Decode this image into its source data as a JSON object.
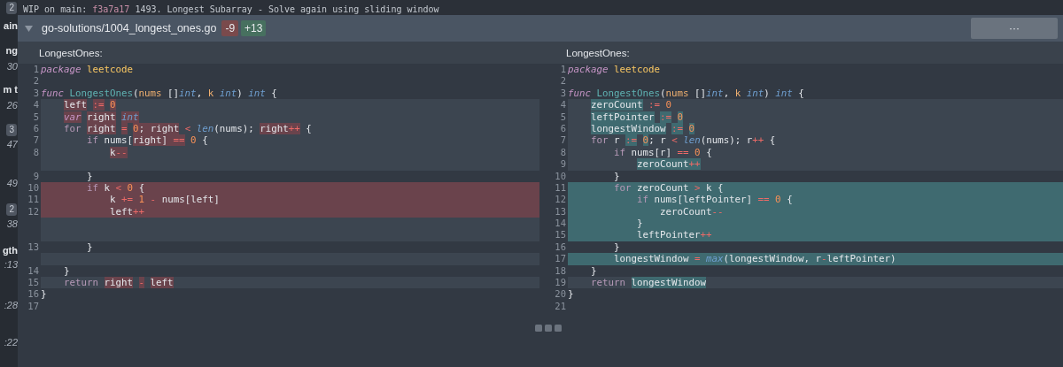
{
  "sidebar": {
    "items": [
      {
        "kind": "badge",
        "text": "2"
      },
      {
        "kind": "label",
        "text": "ain"
      },
      {
        "kind": "label",
        "text": "ng"
      },
      {
        "kind": "time",
        "text": "30"
      },
      {
        "kind": "label",
        "text": "m t"
      },
      {
        "kind": "time",
        "text": "26"
      },
      {
        "kind": "badge",
        "text": "3"
      },
      {
        "kind": "time",
        "text": "47"
      },
      {
        "kind": "time",
        "text": "49"
      },
      {
        "kind": "badge",
        "text": "2"
      },
      {
        "kind": "time",
        "text": "38"
      },
      {
        "kind": "label",
        "text": "gth"
      },
      {
        "kind": "time",
        "text": ":13"
      },
      {
        "kind": "time",
        "text": ":28"
      },
      {
        "kind": "time",
        "text": ":22"
      }
    ]
  },
  "commit": {
    "prefix": "WIP on main:",
    "hash": "f3a7a17",
    "message": "1493. Longest Subarray - Solve again using sliding window"
  },
  "file_header": {
    "expanded": true,
    "path": "go-solutions/1004_longest_ones.go",
    "deletions": "-9",
    "additions": "+13",
    "more": "···"
  },
  "panes": [
    {
      "title": "LongestOnes:",
      "lines": [
        {
          "kind": "context",
          "num": "1",
          "segments": [
            {
              "text": "package",
              "kind": "declaration",
              "highlighted": false
            },
            {
              "text": " leetcode",
              "kind": "package",
              "highlighted": false
            }
          ]
        },
        {
          "kind": "context",
          "num": "2"
        },
        {
          "kind": "context",
          "num": "3",
          "segments": [
            {
              "text": "func",
              "kind": "declaration",
              "highlighted": false
            },
            {
              "text": " LongestOnes",
              "kind": "function",
              "highlighted": false
            },
            {
              "text": "(",
              "kind": "identifier",
              "highlighted": false
            },
            {
              "text": "nums",
              "kind": "parameter",
              "highlighted": false
            },
            {
              "text": " []",
              "kind": "identifier",
              "highlighted": false
            },
            {
              "text": "int",
              "kind": "type",
              "highlighted": false
            },
            {
              "text": ", ",
              "kind": "identifier",
              "highlighted": false
            },
            {
              "text": "k",
              "kind": "parameter",
              "highlighted": false
            },
            {
              "text": " int",
              "kind": "type",
              "highlighted": false
            },
            {
              "text": ") ",
              "kind": "identifier",
              "highlighted": false
            },
            {
              "text": "int",
              "kind": "type",
              "highlighted": false
            },
            {
              "text": " {",
              "kind": "identifier",
              "highlighted": false
            }
          ]
        },
        {
          "kind": "modified",
          "num": "4",
          "segments": [
            {
              "text": "    left",
              "kind": "identifier",
              "highlighted": true
            },
            {
              "text": " :=",
              "kind": "operator",
              "highlighted": true
            },
            {
              "text": " 0",
              "kind": "number",
              "highlighted": true
            }
          ]
        },
        {
          "kind": "modified",
          "num": "5",
          "segments": [
            {
              "text": "    var",
              "kind": "declaration",
              "highlighted": true
            },
            {
              "text": " right",
              "kind": "identifier",
              "highlighted": true
            },
            {
              "text": " int",
              "kind": "type",
              "highlighted": true
            }
          ]
        },
        {
          "kind": "modified",
          "num": "6",
          "segments": [
            {
              "text": "    for",
              "kind": "keyword",
              "highlighted": false
            },
            {
              "text": " right",
              "kind": "identifier",
              "highlighted": true
            },
            {
              "text": " =",
              "kind": "operator",
              "highlighted": true
            },
            {
              "text": " 0",
              "kind": "number",
              "highlighted": true
            },
            {
              "text": "; right",
              "kind": "identifier",
              "highlighted": true
            },
            {
              "text": " <",
              "kind": "operator",
              "highlighted": false
            },
            {
              "text": " len",
              "kind": "builtin",
              "highlighted": false
            },
            {
              "text": "(nums); ",
              "kind": "identifier",
              "highlighted": false
            },
            {
              "text": "right",
              "kind": "identifier",
              "highlighted": true
            },
            {
              "text": "++",
              "kind": "operator",
              "highlighted": true
            },
            {
              "text": " {",
              "kind": "identifier",
              "highlighted": false
            }
          ]
        },
        {
          "kind": "modified",
          "num": "7",
          "segments": [
            {
              "text": "        if",
              "kind": "keyword",
              "highlighted": false
            },
            {
              "text": " nums[",
              "kind": "identifier",
              "highlighted": false
            },
            {
              "text": "right] ",
              "kind": "identifier",
              "highlighted": true
            },
            {
              "text": "==",
              "kind": "operator",
              "highlighted": true
            },
            {
              "text": " 0",
              "kind": "number",
              "highlighted": false
            },
            {
              "text": " {",
              "kind": "identifier",
              "highlighted": false
            }
          ]
        },
        {
          "kind": "modified",
          "num": "8",
          "segments": [
            {
              "text": "            k",
              "kind": "identifier",
              "highlighted": true
            },
            {
              "text": "--",
              "kind": "operator",
              "highlighted": true
            }
          ]
        },
        {
          "kind": "spacer"
        },
        {
          "kind": "context",
          "num": "9",
          "segments": [
            {
              "text": "        }",
              "kind": "identifier",
              "highlighted": false
            }
          ]
        },
        {
          "kind": "removed",
          "num": "10",
          "segments": [
            {
              "text": "        if",
              "kind": "keyword",
              "highlighted": false
            },
            {
              "text": " k ",
              "kind": "identifier",
              "highlighted": false
            },
            {
              "text": "<",
              "kind": "operator",
              "highlighted": false
            },
            {
              "text": " 0",
              "kind": "number",
              "highlighted": false
            },
            {
              "text": " {",
              "kind": "identifier",
              "highlighted": false
            }
          ]
        },
        {
          "kind": "removed",
          "num": "11",
          "segments": [
            {
              "text": "            k ",
              "kind": "identifier",
              "highlighted": false
            },
            {
              "text": "+=",
              "kind": "operator",
              "highlighted": false
            },
            {
              "text": " 1",
              "kind": "number",
              "highlighted": false
            },
            {
              "text": " -",
              "kind": "operator",
              "highlighted": false
            },
            {
              "text": " nums[left]",
              "kind": "identifier",
              "highlighted": false
            }
          ]
        },
        {
          "kind": "removed",
          "num": "12",
          "segments": [
            {
              "text": "            left",
              "kind": "identifier",
              "highlighted": false
            },
            {
              "text": "++",
              "kind": "operator",
              "highlighted": false
            }
          ]
        },
        {
          "kind": "spacer"
        },
        {
          "kind": "spacer"
        },
        {
          "kind": "context",
          "num": "13",
          "segments": [
            {
              "text": "        }",
              "kind": "identifier",
              "highlighted": false
            }
          ]
        },
        {
          "kind": "spacer"
        },
        {
          "kind": "context",
          "num": "14",
          "segments": [
            {
              "text": "    }",
              "kind": "identifier",
              "highlighted": false
            }
          ]
        },
        {
          "kind": "modified",
          "num": "15",
          "segments": [
            {
              "text": "    return",
              "kind": "keyword",
              "highlighted": false
            },
            {
              "text": " right",
              "kind": "identifier",
              "highlighted": true
            },
            {
              "text": " -",
              "kind": "operator",
              "highlighted": true
            },
            {
              "text": " left",
              "kind": "identifier",
              "highlighted": true
            }
          ]
        },
        {
          "kind": "context",
          "num": "16",
          "segments": [
            {
              "text": "}",
              "kind": "identifier",
              "highlighted": false
            }
          ]
        },
        {
          "kind": "context",
          "num": "17"
        }
      ]
    },
    {
      "title": "LongestOnes:",
      "lines": [
        {
          "kind": "context",
          "num": "1",
          "segments": [
            {
              "text": "package",
              "kind": "declaration",
              "highlighted": false
            },
            {
              "text": " leetcode",
              "kind": "package",
              "highlighted": false
            }
          ]
        },
        {
          "kind": "context",
          "num": "2"
        },
        {
          "kind": "context",
          "num": "3",
          "segments": [
            {
              "text": "func",
              "kind": "declaration",
              "highlighted": false
            },
            {
              "text": " LongestOnes",
              "kind": "function",
              "highlighted": false
            },
            {
              "text": "(",
              "kind": "identifier",
              "highlighted": false
            },
            {
              "text": "nums",
              "kind": "parameter",
              "highlighted": false
            },
            {
              "text": " []",
              "kind": "identifier",
              "highlighted": false
            },
            {
              "text": "int",
              "kind": "type",
              "highlighted": false
            },
            {
              "text": ", ",
              "kind": "identifier",
              "highlighted": false
            },
            {
              "text": "k",
              "kind": "parameter",
              "highlighted": false
            },
            {
              "text": " int",
              "kind": "type",
              "highlighted": false
            },
            {
              "text": ") ",
              "kind": "identifier",
              "highlighted": false
            },
            {
              "text": "int",
              "kind": "type",
              "highlighted": false
            },
            {
              "text": " {",
              "kind": "identifier",
              "highlighted": false
            }
          ]
        },
        {
          "kind": "modified",
          "num": "4",
          "segments": [
            {
              "text": "    zeroCount",
              "kind": "identifier",
              "highlighted": true
            },
            {
              "text": " :=",
              "kind": "operator",
              "highlighted": false
            },
            {
              "text": " 0",
              "kind": "number",
              "highlighted": false
            }
          ]
        },
        {
          "kind": "modified",
          "num": "5",
          "segments": [
            {
              "text": "    leftPointer",
              "kind": "identifier",
              "highlighted": true
            },
            {
              "text": " :=",
              "kind": "operator",
              "highlighted": true
            },
            {
              "text": " 0",
              "kind": "number",
              "highlighted": true
            }
          ]
        },
        {
          "kind": "modified",
          "num": "6",
          "segments": [
            {
              "text": "    longestWindow",
              "kind": "identifier",
              "highlighted": true
            },
            {
              "text": " :=",
              "kind": "operator",
              "highlighted": true
            },
            {
              "text": " 0",
              "kind": "number",
              "highlighted": true
            }
          ]
        },
        {
          "kind": "modified",
          "num": "7",
          "segments": [
            {
              "text": "    for",
              "kind": "keyword",
              "highlighted": false
            },
            {
              "text": " r",
              "kind": "identifier",
              "highlighted": false
            },
            {
              "text": " :=",
              "kind": "operator",
              "highlighted": true
            },
            {
              "text": " 0",
              "kind": "number",
              "highlighted": true
            },
            {
              "text": "; r",
              "kind": "identifier",
              "highlighted": false
            },
            {
              "text": " <",
              "kind": "operator",
              "highlighted": false
            },
            {
              "text": " len",
              "kind": "builtin",
              "highlighted": false
            },
            {
              "text": "(nums); r",
              "kind": "identifier",
              "highlighted": false
            },
            {
              "text": "++",
              "kind": "operator",
              "highlighted": false
            },
            {
              "text": " {",
              "kind": "identifier",
              "highlighted": false
            }
          ]
        },
        {
          "kind": "modified",
          "num": "8",
          "segments": [
            {
              "text": "        if",
              "kind": "keyword",
              "highlighted": false
            },
            {
              "text": " nums[r] ",
              "kind": "identifier",
              "highlighted": false
            },
            {
              "text": "==",
              "kind": "operator",
              "highlighted": false
            },
            {
              "text": " 0",
              "kind": "number",
              "highlighted": false
            },
            {
              "text": " {",
              "kind": "identifier",
              "highlighted": false
            }
          ]
        },
        {
          "kind": "modified",
          "num": "9",
          "segments": [
            {
              "text": "            zeroCount",
              "kind": "identifier",
              "highlighted": true
            },
            {
              "text": "++",
              "kind": "operator",
              "highlighted": true
            }
          ]
        },
        {
          "kind": "context",
          "num": "10",
          "segments": [
            {
              "text": "        }",
              "kind": "identifier",
              "highlighted": false
            }
          ]
        },
        {
          "kind": "added",
          "num": "11",
          "segments": [
            {
              "text": "        for",
              "kind": "keyword",
              "highlighted": false
            },
            {
              "text": " zeroCount ",
              "kind": "identifier",
              "highlighted": false
            },
            {
              "text": ">",
              "kind": "operator",
              "highlighted": false
            },
            {
              "text": " k {",
              "kind": "identifier",
              "highlighted": false
            }
          ]
        },
        {
          "kind": "added",
          "num": "12",
          "segments": [
            {
              "text": "            if",
              "kind": "keyword",
              "highlighted": false
            },
            {
              "text": " nums[leftPointer] ",
              "kind": "identifier",
              "highlighted": false
            },
            {
              "text": "==",
              "kind": "operator",
              "highlighted": false
            },
            {
              "text": " 0",
              "kind": "number",
              "highlighted": false
            },
            {
              "text": " {",
              "kind": "identifier",
              "highlighted": false
            }
          ]
        },
        {
          "kind": "added",
          "num": "13",
          "segments": [
            {
              "text": "                zeroCount",
              "kind": "identifier",
              "highlighted": false
            },
            {
              "text": "--",
              "kind": "operator",
              "highlighted": false
            }
          ]
        },
        {
          "kind": "added",
          "num": "14",
          "segments": [
            {
              "text": "            }",
              "kind": "identifier",
              "highlighted": false
            }
          ]
        },
        {
          "kind": "added",
          "num": "15",
          "segments": [
            {
              "text": "            leftPointer",
              "kind": "identifier",
              "highlighted": false
            },
            {
              "text": "++",
              "kind": "operator",
              "highlighted": false
            }
          ]
        },
        {
          "kind": "context",
          "num": "16",
          "segments": [
            {
              "text": "        }",
              "kind": "identifier",
              "highlighted": false
            }
          ]
        },
        {
          "kind": "added",
          "num": "17",
          "segments": [
            {
              "text": "        longestWindow ",
              "kind": "identifier",
              "highlighted": false
            },
            {
              "text": "=",
              "kind": "operator",
              "highlighted": false
            },
            {
              "text": " max",
              "kind": "builtin",
              "highlighted": false
            },
            {
              "text": "(longestWindow, r",
              "kind": "identifier",
              "highlighted": false
            },
            {
              "text": "-",
              "kind": "operator",
              "highlighted": false
            },
            {
              "text": "leftPointer)",
              "kind": "identifier",
              "highlighted": false
            }
          ]
        },
        {
          "kind": "context",
          "num": "18",
          "segments": [
            {
              "text": "    }",
              "kind": "identifier",
              "highlighted": false
            }
          ]
        },
        {
          "kind": "modified",
          "num": "19",
          "segments": [
            {
              "text": "    return",
              "kind": "keyword",
              "highlighted": false
            },
            {
              "text": " longestWindow",
              "kind": "identifier",
              "highlighted": true
            }
          ]
        },
        {
          "kind": "context",
          "num": "20",
          "segments": [
            {
              "text": "}",
              "kind": "identifier",
              "highlighted": false
            }
          ]
        },
        {
          "kind": "context",
          "num": "21"
        }
      ]
    }
  ]
}
